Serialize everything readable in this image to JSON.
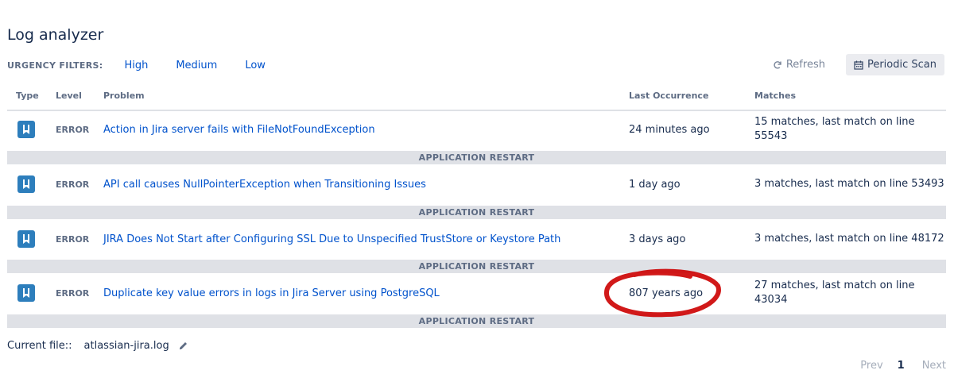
{
  "title": "Log analyzer",
  "filters": {
    "label": "URGENCY FILTERS:",
    "high": "High",
    "medium": "Medium",
    "low": "Low"
  },
  "actions": {
    "refresh": "Refresh",
    "periodic": "Periodic Scan",
    "refresh_icon": "refresh-icon",
    "periodic_icon": "calendar-icon"
  },
  "columns": {
    "type": "Type",
    "level": "Level",
    "problem": "Problem",
    "last": "Last Occurrence",
    "matches": "Matches"
  },
  "rows": [
    {
      "level": "ERROR",
      "problem": "Action in Jira server fails with FileNotFoundException",
      "last": "24 minutes ago",
      "matches": "15 matches, last match on line 55543"
    },
    {
      "level": "ERROR",
      "problem": "API call causes NullPointerException when Transitioning Issues",
      "last": "1 day ago",
      "matches": "3 matches, last match on line 53493"
    },
    {
      "level": "ERROR",
      "problem": "JIRA Does Not Start after Configuring SSL Due to Unspecified TrustStore or Keystore Path",
      "last": "3 days ago",
      "matches": "3 matches, last match on line 48172"
    },
    {
      "level": "ERROR",
      "problem": "Duplicate key value errors in logs in Jira Server using PostgreSQL",
      "last": "807 years ago",
      "matches": "27 matches, last match on line 43034"
    }
  ],
  "restart_label": "APPLICATION RESTART",
  "footer": {
    "current_file_label": "Current file::",
    "file_name": "atlassian-jira.log",
    "edit_icon": "pencil-icon"
  },
  "pager": {
    "prev": "Prev",
    "page": "1",
    "next": "Next"
  },
  "colors": {
    "link": "#0052cc",
    "muted": "#5e6c84",
    "restart_bg": "#dfe1e6",
    "annotation": "#cc0000"
  }
}
